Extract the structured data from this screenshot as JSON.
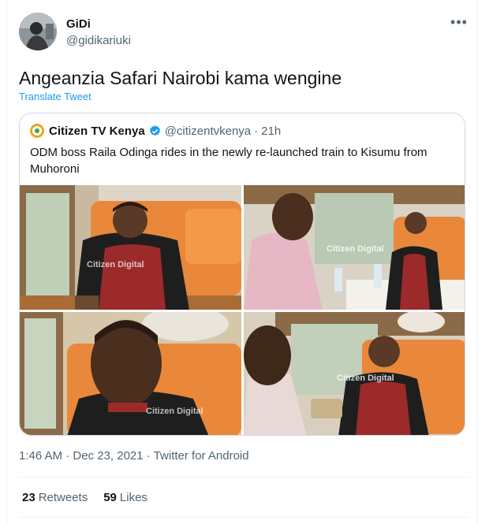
{
  "author": {
    "name": "GiDi",
    "handle": "@gidikariuki"
  },
  "tweet": {
    "text": "Angeanzia Safari Nairobi kama wengine",
    "translate_label": "Translate Tweet"
  },
  "quoted": {
    "name": "Citizen TV Kenya",
    "handle": "@citizentvkenya",
    "separator": "·",
    "time": "21h",
    "text": "ODM boss Raila Odinga rides in the newly re-launched train to Kisumu from Muhoroni",
    "watermark": "Citizen Digital"
  },
  "meta": {
    "time": "1:46 AM",
    "separator": "·",
    "date": "Dec 23, 2021",
    "source": "Twitter for Android"
  },
  "stats": {
    "retweets_count": "23",
    "retweets_label": "Retweets",
    "likes_count": "59",
    "likes_label": "Likes"
  },
  "colors": {
    "accent": "#1d9bf0",
    "seat_orange": "#e9883a",
    "secondary_text": "#536471"
  }
}
